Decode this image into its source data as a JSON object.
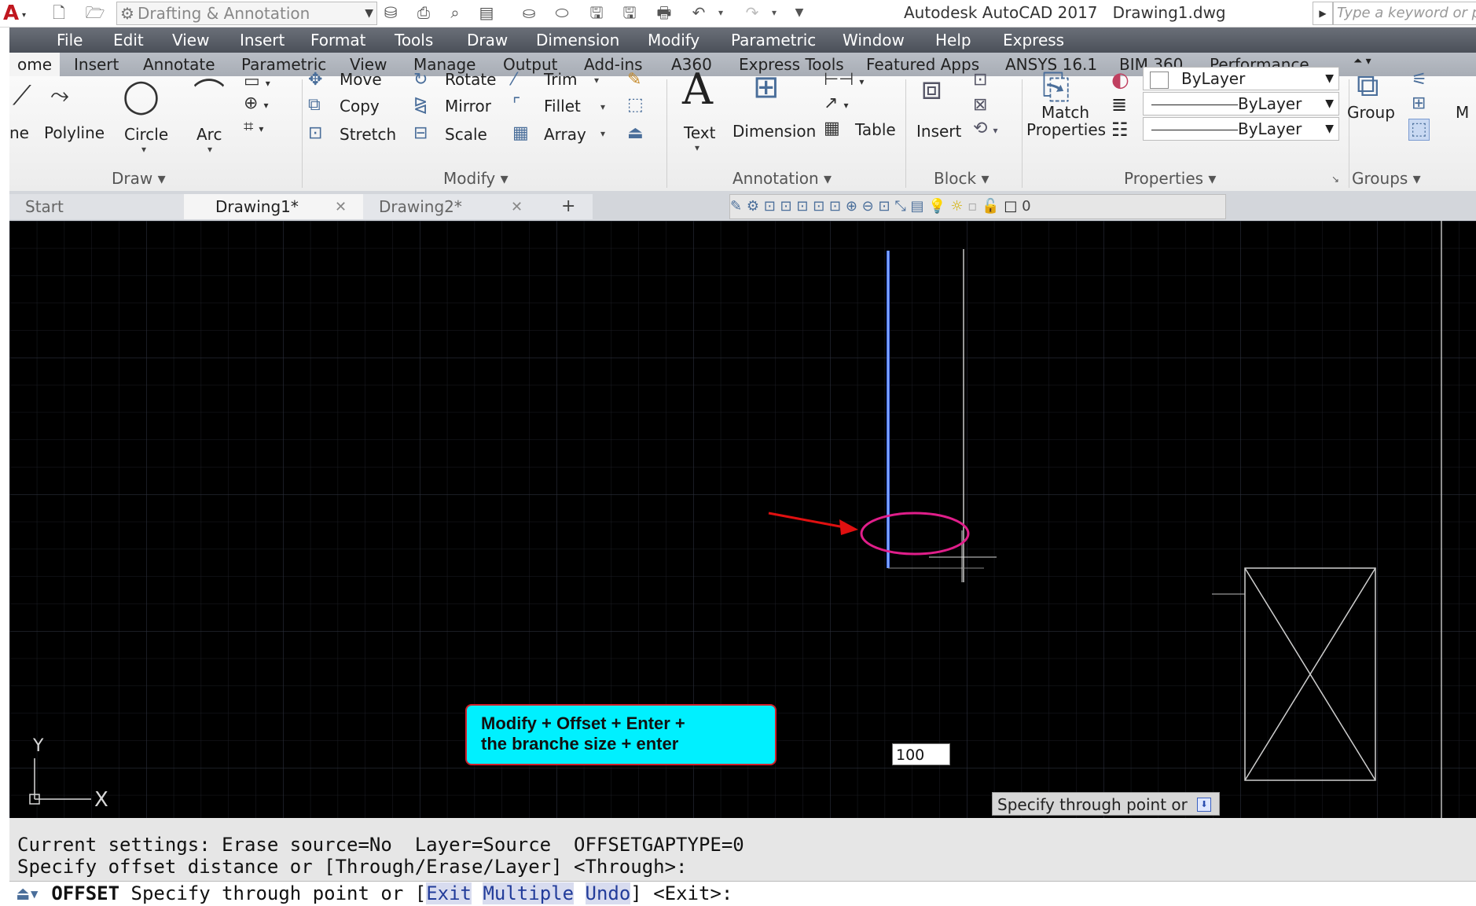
{
  "titlebar": {
    "workspace": "Drafting & Annotation",
    "app_title": "Autodesk AutoCAD 2017",
    "file_name": "Drawing1.dwg",
    "search_placeholder": "Type a keyword or p",
    "qat_icons": [
      "new-icon",
      "open-icon",
      "save-icon",
      "save-as-icon",
      "plot-icon",
      "undo-icon",
      "redo-icon"
    ]
  },
  "menubar": {
    "items": [
      "File",
      "Edit",
      "View",
      "Insert",
      "Format",
      "Tools",
      "Draw",
      "Dimension",
      "Modify",
      "Parametric",
      "Window",
      "Help",
      "Express"
    ]
  },
  "ribbon_tabs": {
    "items": [
      "ome",
      "Insert",
      "Annotate",
      "Parametric",
      "View",
      "Manage",
      "Output",
      "Add-ins",
      "A360",
      "Express Tools",
      "Featured Apps",
      "ANSYS 16.1",
      "BIM 360",
      "Performance"
    ],
    "active": "ome"
  },
  "ribbon": {
    "draw": {
      "title": "Draw",
      "line_label": "ne",
      "polyline_label": "Polyline",
      "circle_label": "Circle",
      "arc_label": "Arc"
    },
    "modify": {
      "title": "Modify",
      "move": "Move",
      "rotate": "Rotate",
      "trim": "Trim",
      "copy": "Copy",
      "mirror": "Mirror",
      "fillet": "Fillet",
      "stretch": "Stretch",
      "scale": "Scale",
      "array": "Array"
    },
    "annotation": {
      "title": "Annotation",
      "text": "Text",
      "dimension": "Dimension",
      "table": "Table"
    },
    "block": {
      "title": "Block",
      "insert": "Insert"
    },
    "properties": {
      "title": "Properties",
      "match_line1": "Match",
      "match_line2": "Properties",
      "color": "ByLayer",
      "linetype": "ByLayer",
      "lineweight": "ByLayer"
    },
    "groups": {
      "title": "Groups",
      "group": "Group",
      "more": "M"
    }
  },
  "doc_tabs": {
    "start": "Start",
    "drawing1": "Drawing1*",
    "drawing2": "Drawing2*",
    "add": "+",
    "layer_value": "0"
  },
  "canvas": {
    "callout_line1": "Modify + Offset + Enter +",
    "callout_line2": "the branche size + enter",
    "input_value": "100",
    "tooltip": "Specify through point or",
    "ucs_x": "X",
    "ucs_y": "Y",
    "accent_color": "#00f0ff",
    "selected_line_color": "#3b6cff"
  },
  "command": {
    "history_line1": "Current settings: Erase source=No  Layer=Source  OFFSETGAPTYPE=0",
    "history_line2": "Specify offset distance or [Through/Erase/Layer] <Through>:",
    "command_name": "OFFSET",
    "prompt_prefix": "Specify through point or [",
    "opt_exit": "Exit",
    "opt_multiple": "Multiple",
    "opt_undo": "Undo",
    "prompt_suffix": "] <Exit>:"
  }
}
